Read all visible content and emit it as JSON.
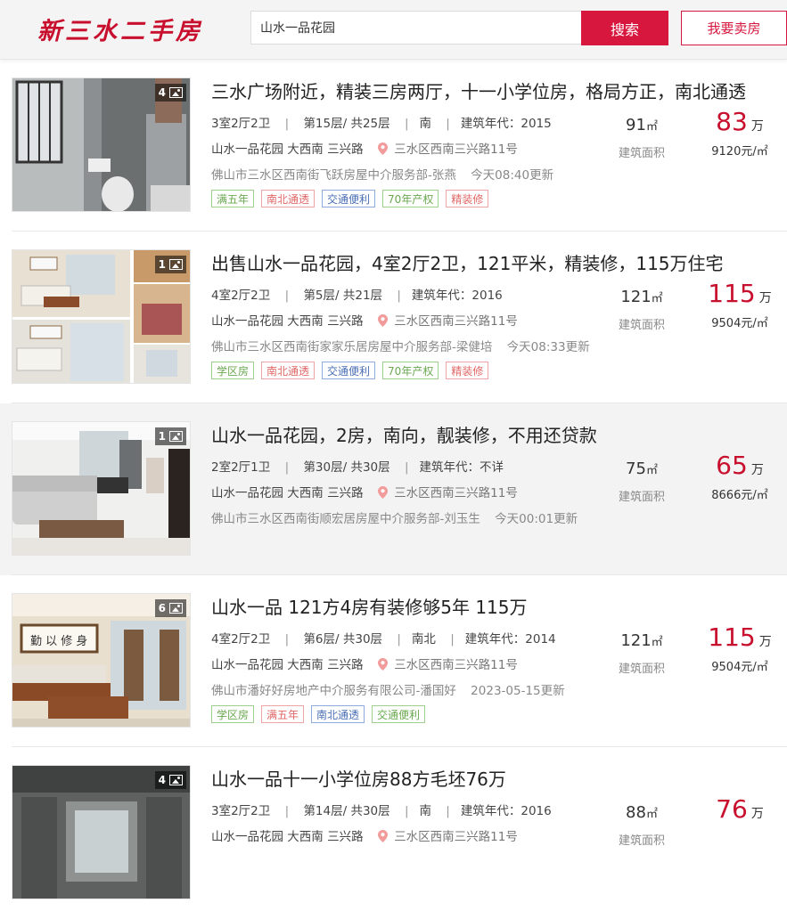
{
  "header": {
    "logo": "新三水二手房",
    "search_value": "山水一品花园",
    "search_button": "搜索",
    "sell_button": "我要卖房"
  },
  "listings": [
    {
      "photo_count": "4",
      "title": "三水广场附近，精装三房两厅，十一小学位房，格局方正，南北通透",
      "layout": "3室2厅2卫",
      "floor": "第15层/ 共25层",
      "orientation": "南",
      "year": "建筑年代：2015",
      "community": "山水一品花园 大西南 三兴路",
      "road": "三水区西南三兴路11号",
      "agency": "佛山市三水区西南街飞跃房屋中介服务部-张燕",
      "time": "今天08:40更新",
      "tags": [
        {
          "text": "满五年",
          "color": "green"
        },
        {
          "text": "南北通透",
          "color": "red"
        },
        {
          "text": "交通便利",
          "color": "blue"
        },
        {
          "text": "70年产权",
          "color": "green"
        },
        {
          "text": "精装修",
          "color": "red"
        }
      ],
      "area": "91",
      "area_unit": "㎡",
      "area_label": "建筑面积",
      "price": "83",
      "price_unit": "万",
      "unit_price": "9120元/㎡"
    },
    {
      "photo_count": "1",
      "title": "出售山水一品花园，4室2厅2卫，121平米，精装修，115万住宅",
      "layout": "4室2厅2卫",
      "floor": "第5层/ 共21层",
      "orientation": "",
      "year": "建筑年代：2016",
      "community": "山水一品花园 大西南 三兴路",
      "road": "三水区西南三兴路11号",
      "agency": "佛山市三水区西南街家家乐居房屋中介服务部-梁健培",
      "time": "今天08:33更新",
      "tags": [
        {
          "text": "学区房",
          "color": "green"
        },
        {
          "text": "南北通透",
          "color": "red"
        },
        {
          "text": "交通便利",
          "color": "blue"
        },
        {
          "text": "70年产权",
          "color": "green"
        },
        {
          "text": "精装修",
          "color": "red"
        }
      ],
      "area": "121",
      "area_unit": "㎡",
      "area_label": "建筑面积",
      "price": "115",
      "price_unit": "万",
      "unit_price": "9504元/㎡"
    },
    {
      "photo_count": "1",
      "title": "山水一品花园，2房，南向，靓装修，不用还贷款",
      "layout": "2室2厅1卫",
      "floor": "第30层/ 共30层",
      "orientation": "",
      "year": "建筑年代：不详",
      "community": "山水一品花园 大西南 三兴路",
      "road": "三水区西南三兴路11号",
      "agency": "佛山市三水区西南街顺宏居房屋中介服务部-刘玉生",
      "time": "今天00:01更新",
      "tags": [],
      "area": "75",
      "area_unit": "㎡",
      "area_label": "建筑面积",
      "price": "65",
      "price_unit": "万",
      "unit_price": "8666元/㎡"
    },
    {
      "photo_count": "6",
      "title": "山水一品 121方4房有装修够5年 115万",
      "layout": "4室2厅2卫",
      "floor": "第6层/ 共30层",
      "orientation": "南北",
      "year": "建筑年代：2014",
      "community": "山水一品花园 大西南 三兴路",
      "road": "三水区西南三兴路11号",
      "agency": "佛山市潘好好房地产中介服务有限公司-潘国好",
      "time": "2023-05-15更新",
      "tags": [
        {
          "text": "学区房",
          "color": "green"
        },
        {
          "text": "满五年",
          "color": "red"
        },
        {
          "text": "南北通透",
          "color": "blue"
        },
        {
          "text": "交通便利",
          "color": "green"
        }
      ],
      "area": "121",
      "area_unit": "㎡",
      "area_label": "建筑面积",
      "price": "115",
      "price_unit": "万",
      "unit_price": "9504元/㎡"
    },
    {
      "photo_count": "4",
      "title": "山水一品十一小学位房88方毛坯76万",
      "layout": "3室2厅2卫",
      "floor": "第14层/ 共30层",
      "orientation": "南",
      "year": "建筑年代：2016",
      "community": "山水一品花园 大西南 三兴路",
      "road": "三水区西南三兴路11号",
      "agency": "",
      "time": "",
      "tags": [],
      "area": "88",
      "area_unit": "㎡",
      "area_label": "建筑面积",
      "price": "76",
      "price_unit": "万",
      "unit_price": ""
    }
  ]
}
